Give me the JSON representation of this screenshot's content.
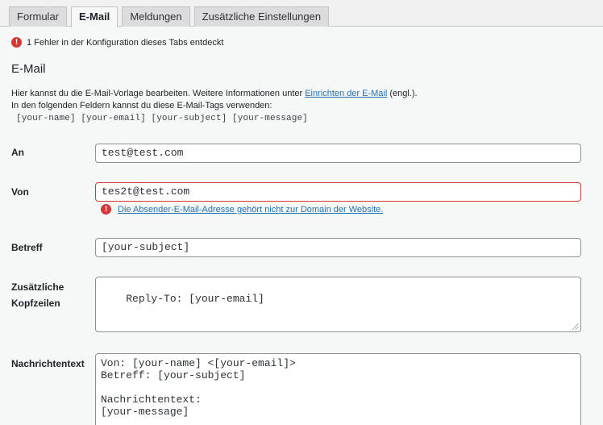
{
  "tabs": [
    {
      "label": "Formular",
      "active": false
    },
    {
      "label": "E-Mail",
      "active": true
    },
    {
      "label": "Meldungen",
      "active": false
    },
    {
      "label": "Zusätzliche Einstellungen",
      "active": false
    }
  ],
  "notice": {
    "icon": "error-icon",
    "text": "1 Fehler in der Konfiguration dieses Tabs entdeckt"
  },
  "section": {
    "title": "E-Mail",
    "desc_line1_before": "Hier kannst du die E-Mail-Vorlage bearbeiten. Weitere Informationen unter ",
    "desc_link": "Einrichten der E-Mail",
    "desc_line1_after": " (engl.).",
    "desc_line2": "In den folgenden Feldern kannst du diese E-Mail-Tags verwenden:",
    "tags": "[your-name] [your-email] [your-subject] [your-message]"
  },
  "fields": {
    "an": {
      "label": "An",
      "value": "test@test.com"
    },
    "von": {
      "label": "Von",
      "value": "tes2t@test.com",
      "error": "Die Absender-E-Mail-Adresse gehört nicht zur Domain der Website."
    },
    "betreff": {
      "label": "Betreff",
      "value": "[your-subject]"
    },
    "kopfzeilen": {
      "label_line1": "Zusätzliche",
      "label_line2": "Kopfzeilen",
      "value": "Reply-To: [your-email]"
    },
    "nachricht": {
      "label": "Nachrichtentext",
      "value": "Von: [your-name] <[your-email]>\nBetreff: [your-subject]\n\nNachrichtentext:\n[your-message]"
    }
  },
  "colors": {
    "error": "#d63638",
    "link": "#2271b1",
    "panel": "#f6f7f7",
    "background": "#f0f0f1"
  }
}
